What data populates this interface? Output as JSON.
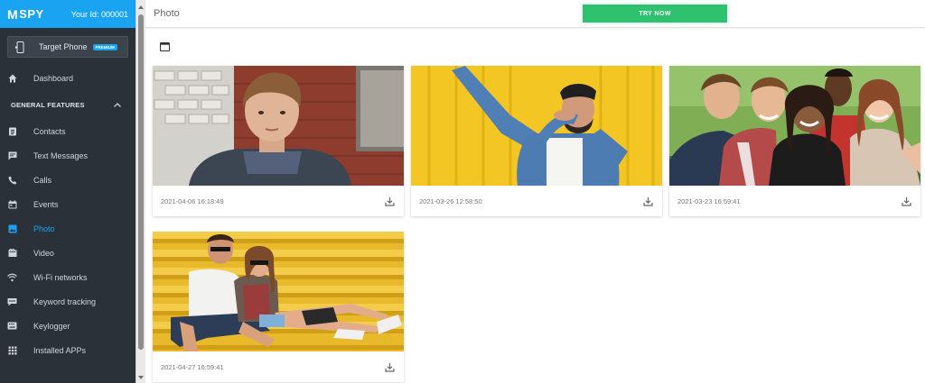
{
  "brand": {
    "logo_mark": "M",
    "logo_text": "SPY",
    "user_id": "Your Id: 000001",
    "accent_color": "#1aa3f0"
  },
  "target_phone": {
    "label": "Target Phone",
    "badge": "PREMIUM",
    "icon": "phone-sync-icon"
  },
  "nav": {
    "dashboard": {
      "label": "Dashboard",
      "icon": "home-icon"
    },
    "section_label": "GENERAL FEATURES",
    "items": [
      {
        "label": "Contacts",
        "icon": "contacts-icon"
      },
      {
        "label": "Text Messages",
        "icon": "message-icon"
      },
      {
        "label": "Calls",
        "icon": "phone-icon"
      },
      {
        "label": "Events",
        "icon": "calendar-icon"
      },
      {
        "label": "Photo",
        "icon": "image-icon",
        "active": true
      },
      {
        "label": "Video",
        "icon": "video-icon"
      },
      {
        "label": "Wi-Fi networks",
        "icon": "wifi-icon"
      },
      {
        "label": "Keyword tracking",
        "icon": "keyword-icon"
      },
      {
        "label": "Keylogger",
        "icon": "keyboard-icon"
      },
      {
        "label": "Installed APPs",
        "icon": "apps-grid-icon"
      }
    ]
  },
  "header": {
    "title": "Photo",
    "cta": "TRY NOW",
    "cta_color": "#2ec170"
  },
  "gallery": {
    "filter_icon": "calendar-icon",
    "photos": [
      {
        "timestamp": "2021-04-06 16:18:49",
        "subject": "young man by brick wall"
      },
      {
        "timestamp": "2021-03-26 12:58:50",
        "subject": "man dabbing on yellow background"
      },
      {
        "timestamp": "2021-03-23 16:59:41",
        "subject": "group selfie of friends"
      },
      {
        "timestamp": "2021-04-27 16:59:41",
        "subject": "couple sitting on yellow bleachers"
      }
    ]
  }
}
